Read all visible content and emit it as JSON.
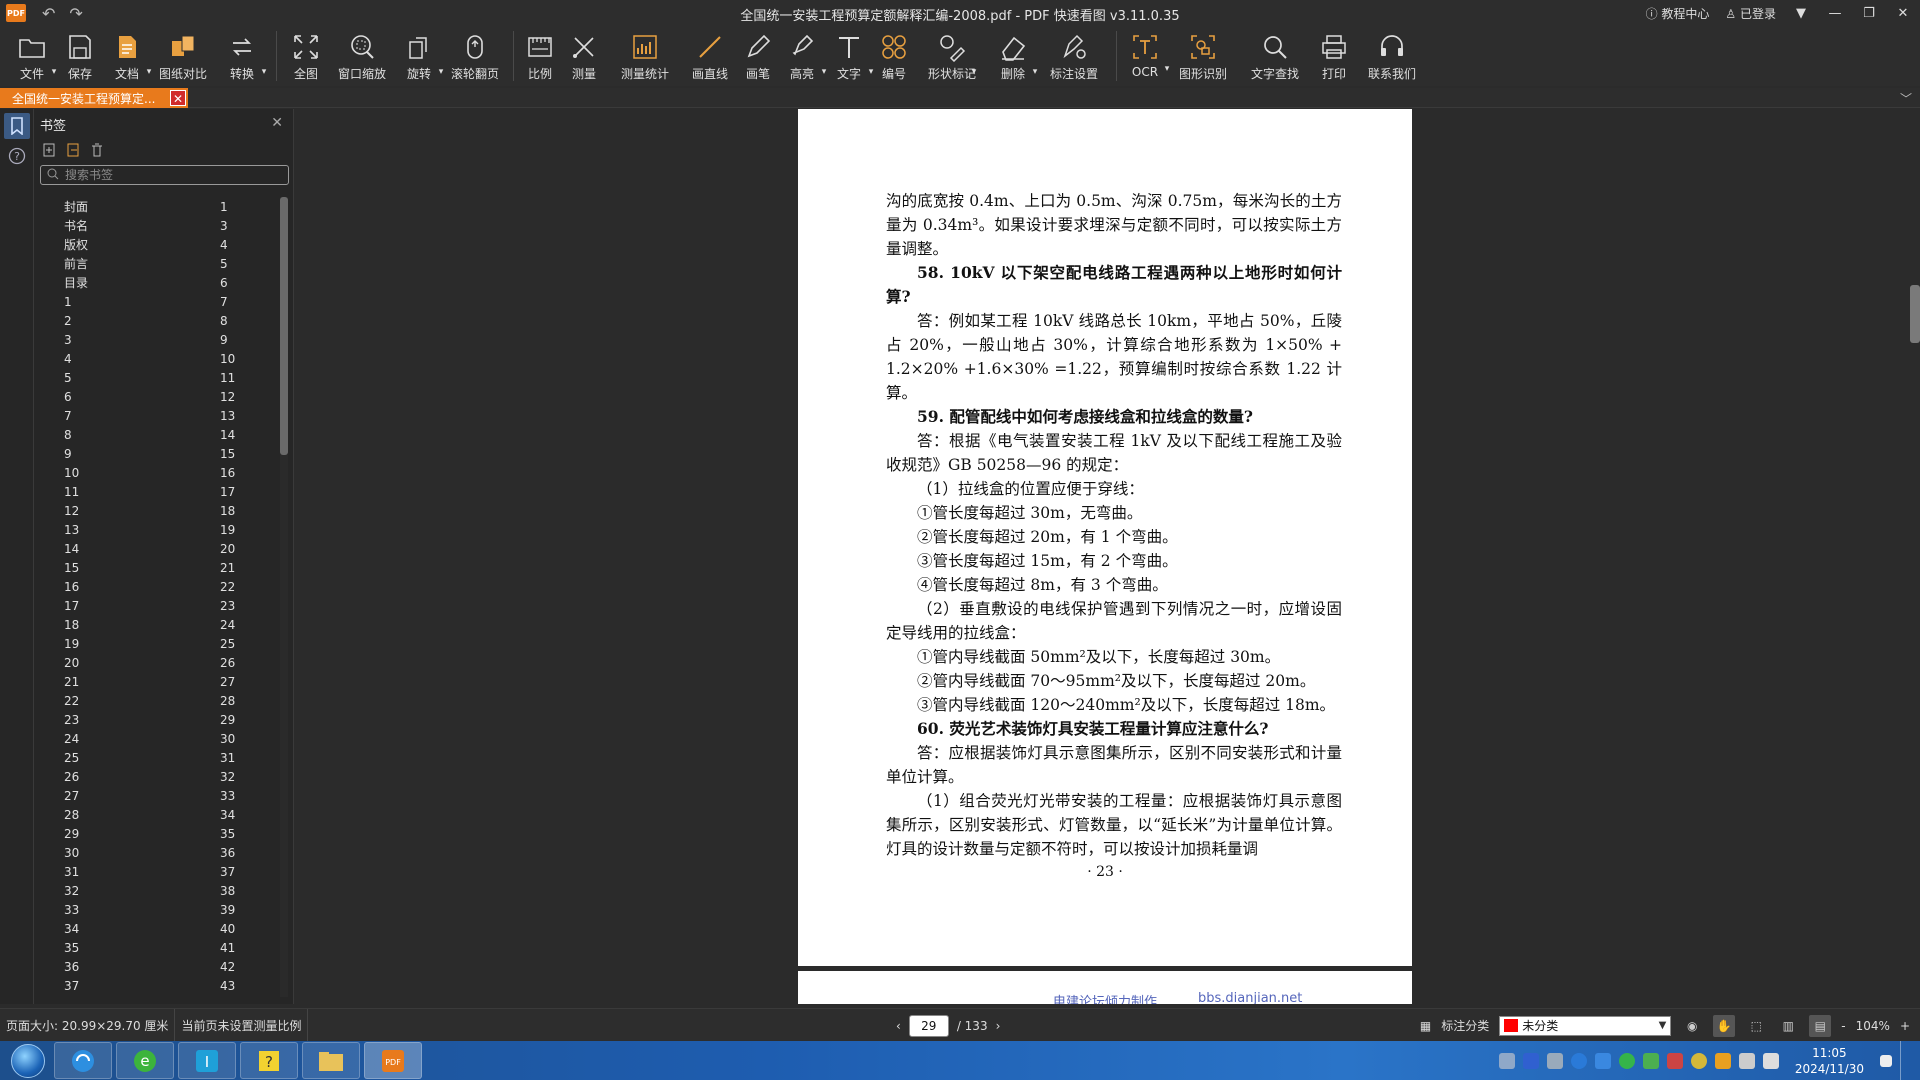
{
  "window": {
    "logo": "PDF",
    "title": "全国统一安装工程预算定额解释汇编-2008.pdf - PDF 快速看图 v3.11.0.35",
    "help_center": "教程中心",
    "login": "已登录"
  },
  "toolbar": [
    {
      "label": "文件",
      "icon": "folder-icon",
      "dropdown": true
    },
    {
      "label": "保存",
      "icon": "save-icon",
      "dropdown": false
    },
    {
      "label": "文档",
      "icon": "document-icon",
      "dropdown": true
    },
    {
      "label": "图纸对比",
      "icon": "compare-icon",
      "dropdown": false
    },
    {
      "label": "转换",
      "icon": "convert-icon",
      "dropdown": true
    },
    {
      "label": "全图",
      "icon": "fit-all-icon",
      "dropdown": false
    },
    {
      "label": "窗口缩放",
      "icon": "zoom-window-icon",
      "dropdown": false
    },
    {
      "label": "旋转",
      "icon": "rotate-icon",
      "dropdown": true
    },
    {
      "label": "滚轮翻页",
      "icon": "mouse-wheel-icon",
      "dropdown": false
    },
    {
      "label": "比例",
      "icon": "scale-icon",
      "dropdown": false
    },
    {
      "label": "测量",
      "icon": "measure-icon",
      "dropdown": false
    },
    {
      "label": "测量统计",
      "icon": "measure-stats-icon",
      "dropdown": false
    },
    {
      "label": "画直线",
      "icon": "line-icon",
      "dropdown": false
    },
    {
      "label": "画笔",
      "icon": "pen-icon",
      "dropdown": false
    },
    {
      "label": "高亮",
      "icon": "highlighter-icon",
      "dropdown": true
    },
    {
      "label": "文字",
      "icon": "text-icon",
      "dropdown": true
    },
    {
      "label": "编号",
      "icon": "numbering-icon",
      "dropdown": false
    },
    {
      "label": "形状标记",
      "icon": "shape-mark-icon",
      "dropdown": true
    },
    {
      "label": "删除",
      "icon": "eraser-icon",
      "dropdown": true
    },
    {
      "label": "标注设置",
      "icon": "annotation-settings-icon",
      "dropdown": false
    },
    {
      "label": "OCR",
      "icon": "ocr-icon",
      "dropdown": true
    },
    {
      "label": "图形识别",
      "icon": "shape-recognition-icon",
      "dropdown": false
    },
    {
      "label": "文字查找",
      "icon": "search-icon",
      "dropdown": false
    },
    {
      "label": "打印",
      "icon": "printer-icon",
      "dropdown": false
    },
    {
      "label": "联系我们",
      "icon": "headset-icon",
      "dropdown": false
    }
  ],
  "tab": {
    "label": "全国统一安装工程预算定..."
  },
  "sidebar": {
    "title": "书签",
    "search_placeholder": "搜索书签",
    "bookmarks": [
      {
        "label": "封面",
        "page": "1"
      },
      {
        "label": "书名",
        "page": "3"
      },
      {
        "label": "版权",
        "page": "4"
      },
      {
        "label": "前言",
        "page": "5"
      },
      {
        "label": "目录",
        "page": "6"
      },
      {
        "label": "1",
        "page": "7"
      },
      {
        "label": "2",
        "page": "8"
      },
      {
        "label": "3",
        "page": "9"
      },
      {
        "label": "4",
        "page": "10"
      },
      {
        "label": "5",
        "page": "11"
      },
      {
        "label": "6",
        "page": "12"
      },
      {
        "label": "7",
        "page": "13"
      },
      {
        "label": "8",
        "page": "14"
      },
      {
        "label": "9",
        "page": "15"
      },
      {
        "label": "10",
        "page": "16"
      },
      {
        "label": "11",
        "page": "17"
      },
      {
        "label": "12",
        "page": "18"
      },
      {
        "label": "13",
        "page": "19"
      },
      {
        "label": "14",
        "page": "20"
      },
      {
        "label": "15",
        "page": "21"
      },
      {
        "label": "16",
        "page": "22"
      },
      {
        "label": "17",
        "page": "23"
      },
      {
        "label": "18",
        "page": "24"
      },
      {
        "label": "19",
        "page": "25"
      },
      {
        "label": "20",
        "page": "26"
      },
      {
        "label": "21",
        "page": "27"
      },
      {
        "label": "22",
        "page": "28"
      },
      {
        "label": "23",
        "page": "29"
      },
      {
        "label": "24",
        "page": "30"
      },
      {
        "label": "25",
        "page": "31"
      },
      {
        "label": "26",
        "page": "32"
      },
      {
        "label": "27",
        "page": "33"
      },
      {
        "label": "28",
        "page": "34"
      },
      {
        "label": "29",
        "page": "35"
      },
      {
        "label": "30",
        "page": "36"
      },
      {
        "label": "31",
        "page": "37"
      },
      {
        "label": "32",
        "page": "38"
      },
      {
        "label": "33",
        "page": "39"
      },
      {
        "label": "34",
        "page": "40"
      },
      {
        "label": "35",
        "page": "41"
      },
      {
        "label": "36",
        "page": "42"
      },
      {
        "label": "37",
        "page": "43"
      }
    ]
  },
  "document": {
    "paragraphs": [
      {
        "text": "沟的底宽按 0.4m、上口为 0.5m、沟深 0.75m，每米沟长的土方量为 0.34m³。如果设计要求埋深与定额不同时，可以按实际土方量调整。",
        "heading": false,
        "indent": false
      },
      {
        "text": "58. 10kV 以下架空配电线路工程遇两种以上地形时如何计算?",
        "heading": true,
        "indent": true
      },
      {
        "text": "答：例如某工程 10kV 线路总长 10km，平地占 50%，丘陵占 20%，一般山地占 30%，计算综合地形系数为 1×50% + 1.2×20% +1.6×30% =1.22，预算编制时按综合系数 1.22 计算。",
        "heading": false,
        "indent": true
      },
      {
        "text": "59. 配管配线中如何考虑接线盒和拉线盒的数量?",
        "heading": true,
        "indent": true
      },
      {
        "text": "答：根据《电气装置安装工程 1kV 及以下配线工程施工及验收规范》GB 50258—96 的规定：",
        "heading": false,
        "indent": true
      },
      {
        "text": "（1）拉线盒的位置应便于穿线：",
        "heading": false,
        "indent": true
      },
      {
        "text": "①管长度每超过 30m，无弯曲。",
        "heading": false,
        "indent": true
      },
      {
        "text": "②管长度每超过 20m，有 1 个弯曲。",
        "heading": false,
        "indent": true
      },
      {
        "text": "③管长度每超过 15m，有 2 个弯曲。",
        "heading": false,
        "indent": true
      },
      {
        "text": "④管长度每超过 8m，有 3 个弯曲。",
        "heading": false,
        "indent": true
      },
      {
        "text": "（2）垂直敷设的电线保护管遇到下列情况之一时，应增设固定导线用的拉线盒：",
        "heading": false,
        "indent": true
      },
      {
        "text": "①管内导线截面 50mm²及以下，长度每超过 30m。",
        "heading": false,
        "indent": true
      },
      {
        "text": "②管内导线截面 70～95mm²及以下，长度每超过 20m。",
        "heading": false,
        "indent": true
      },
      {
        "text": "③管内导线截面 120～240mm²及以下，长度每超过 18m。",
        "heading": false,
        "indent": true
      },
      {
        "text": "60. 荧光艺术装饰灯具安装工程量计算应注意什么?",
        "heading": true,
        "indent": true
      },
      {
        "text": "答：应根据装饰灯具示意图集所示，区别不同安装形式和计量单位计算。",
        "heading": false,
        "indent": true
      },
      {
        "text": "（1）组合荧光灯光带安装的工程量：应根据装饰灯具示意图集所示，区别安装形式、灯管数量，以“延长米”为计量单位计算。灯具的设计数量与定额不符时，可以按设计加损耗量调",
        "heading": false,
        "indent": true
      }
    ],
    "page_number": "· 23 ·",
    "next_page_footer_left": "电建论坛倾力制作",
    "next_page_footer_right": "bbs.dianjian.net"
  },
  "statusbar": {
    "page_size": "页面大小: 20.99×29.70 厘米",
    "scale_note": "当前页未设置测量比例",
    "current_page": "29",
    "total_pages": "/ 133",
    "category_label": "标注分类",
    "category_value": "未分类",
    "category_color": "#ff0000",
    "zoom": "104%",
    "zoom_minus": "-",
    "zoom_plus": "+"
  },
  "taskbar": {
    "time": "11:05",
    "date": "2024/11/30"
  }
}
